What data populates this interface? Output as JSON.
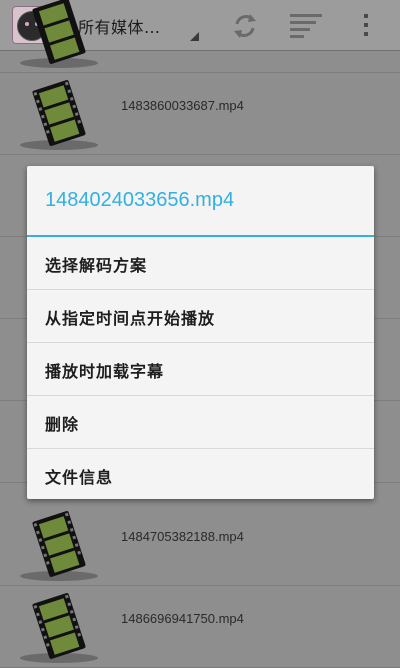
{
  "header": {
    "title": "所有媒体…",
    "icons": [
      "app-icon",
      "refresh-icon",
      "sort-icon",
      "overflow-menu-icon"
    ]
  },
  "files": [
    {
      "name": ""
    },
    {
      "name": "1483860033687.mp4"
    },
    {
      "name": ""
    },
    {
      "name": ""
    },
    {
      "name": ""
    },
    {
      "name": ""
    },
    {
      "name": "1484705382188.mp4"
    },
    {
      "name": "1486696941750.mp4"
    }
  ],
  "dialog": {
    "title": "1484024033656.mp4",
    "items": [
      {
        "label": "选择解码方案"
      },
      {
        "label": "从指定时间点开始播放"
      },
      {
        "label": "播放时加载字幕"
      },
      {
        "label": "删除"
      },
      {
        "label": "文件信息"
      }
    ]
  },
  "colors": {
    "accent": "#33b0e0",
    "dim_background": "#8e8e8e",
    "dialog_background": "#f4f4f4"
  }
}
